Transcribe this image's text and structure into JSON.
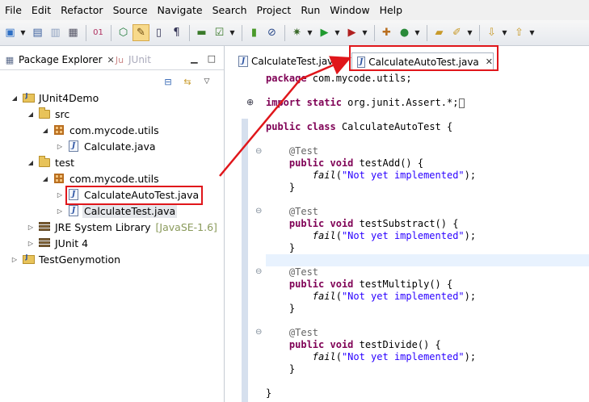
{
  "menubar": {
    "items": [
      "File",
      "Edit",
      "Refactor",
      "Source",
      "Navigate",
      "Search",
      "Project",
      "Run",
      "Window",
      "Help"
    ]
  },
  "left_panel": {
    "active_tab": "Package Explorer",
    "inactive_tab": "JUnit",
    "tree": {
      "project": "JUnit4Demo",
      "src_folder": "src",
      "src_package": "com.mycode.utils",
      "src_file": "Calculate.java",
      "test_folder": "test",
      "test_package": "com.mycode.utils",
      "test_file_1": "CalculateAutoTest.java",
      "test_file_2": "CalculateTest.java",
      "jre_lib": "JRE System Library",
      "jre_version": "[JavaSE-1.6]",
      "junit_lib": "JUnit 4",
      "other_project": "TestGenymotion"
    }
  },
  "editor": {
    "tabs": [
      "CalculateTest.java",
      "CalculateAutoTest.java"
    ],
    "active_tab_index": 1,
    "code": {
      "package_kw": "package",
      "package_name": " com.mycode.utils;",
      "import_kw": "import",
      "static_kw": " static",
      "import_rest": " org.junit.Assert.*;",
      "public_kw": "public",
      "class_kw": " class",
      "class_name": " CalculateAutoTest {",
      "annotation": "@Test",
      "void_kw": " void",
      "fail_call": "fail",
      "fail_msg": "\"Not yet implemented\"",
      "methods": [
        "testAdd",
        "testSubstract",
        "testMultiply",
        "testDivide"
      ],
      "close_brace": "}"
    }
  },
  "colors": {
    "highlight_red": "#e0161b",
    "keyword": "#7f0055",
    "string": "#2a00ff",
    "annotation": "#646464"
  }
}
